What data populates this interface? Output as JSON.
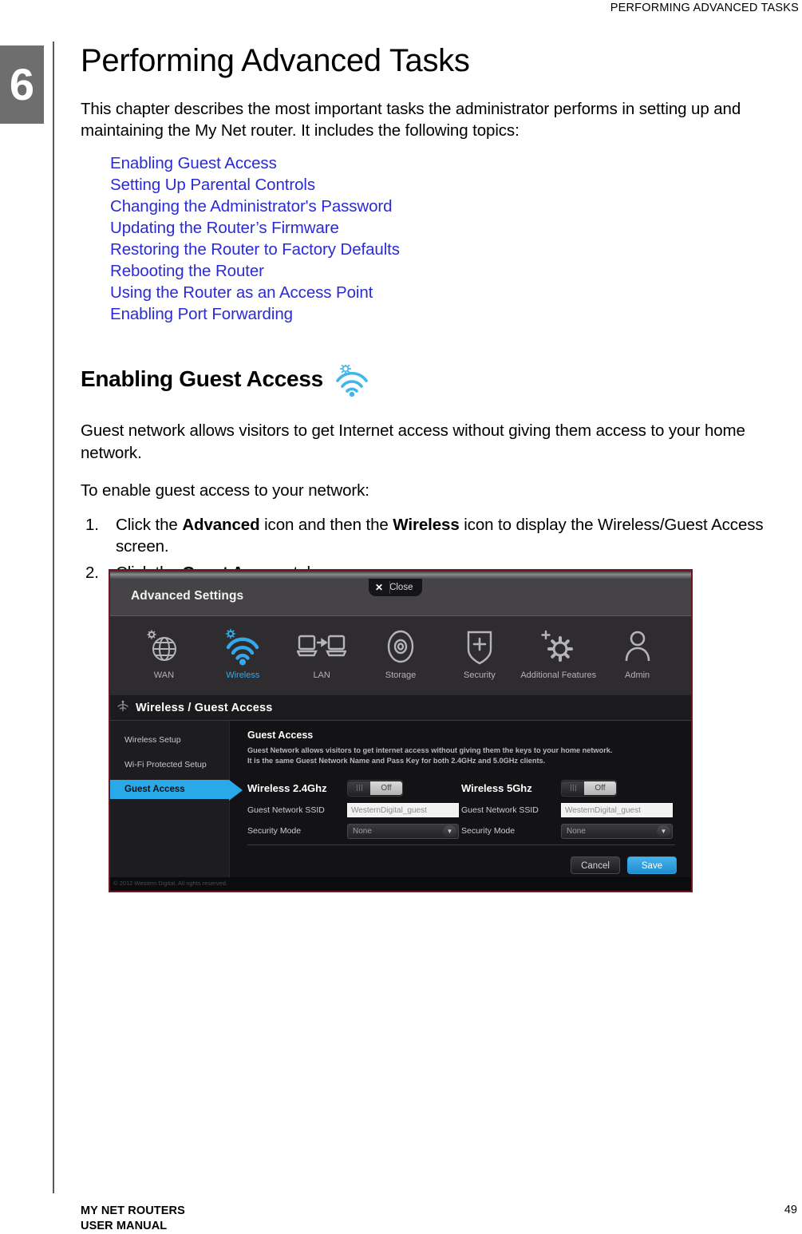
{
  "running_head": "PERFORMING ADVANCED TASKS",
  "chapter_number": "6",
  "page_title": "Performing Advanced Tasks",
  "intro": "This chapter describes the most important tasks the administrator performs in setting up and maintaining the My Net router. It includes the following topics:",
  "toc": [
    "Enabling Guest Access",
    "Setting Up Parental Controls",
    "Changing the Administrator's Password",
    "Updating the Router’s Firmware",
    "Restoring the Router to Factory Defaults",
    "Rebooting the Router",
    "Using the Router as an Access Point",
    "Enabling Port Forwarding"
  ],
  "section": {
    "heading": "Enabling Guest Access",
    "heading_icon": "wireless-gear-icon",
    "paragraph_1": "Guest network allows visitors to get Internet access without giving them access to your home network.",
    "paragraph_2": "To enable guest access to your network:",
    "steps": [
      {
        "num": "1.",
        "parts": [
          {
            "t": "Click the ",
            "b": false
          },
          {
            "t": "Advanced",
            "b": true
          },
          {
            "t": " icon and then the ",
            "b": false
          },
          {
            "t": "Wireless",
            "b": true
          },
          {
            "t": " icon to display the Wireless/Guest Access screen.",
            "b": false
          }
        ]
      },
      {
        "num": "2.",
        "parts": [
          {
            "t": "Click the ",
            "b": false
          },
          {
            "t": "Guest Access",
            "b": true
          },
          {
            "t": " tab.",
            "b": false
          }
        ]
      }
    ]
  },
  "screenshot": {
    "header_title": "Advanced Settings",
    "close_label": "Close",
    "close_x": "✕",
    "nav_icons": [
      {
        "label": "WAN",
        "icon": "globe-gear-icon",
        "active": false
      },
      {
        "label": "Wireless",
        "icon": "wifi-gear-icon",
        "active": true
      },
      {
        "label": "LAN",
        "icon": "computers-arrow-icon",
        "active": false
      },
      {
        "label": "Storage",
        "icon": "disk-icon",
        "active": false
      },
      {
        "label": "Security",
        "icon": "shield-plus-icon",
        "active": false
      },
      {
        "label": "Additional Features",
        "icon": "gear-plus-icon",
        "active": false
      },
      {
        "label": "Admin",
        "icon": "person-icon",
        "active": false
      }
    ],
    "breadcrumb": "Wireless / Guest Access",
    "breadcrumb_icon": "wifi-small-icon",
    "left_nav": [
      {
        "label": "Wireless Setup",
        "selected": false
      },
      {
        "label": "Wi-Fi Protected Setup",
        "selected": false
      },
      {
        "label": "Guest Access",
        "selected": true
      }
    ],
    "pane_title": "Guest Access",
    "pane_desc_line1": "Guest Network allows visitors to get internet access without giving them the keys to your home network.",
    "pane_desc_line2": "It is the same Guest Network Name and Pass Key for both 2.4GHz and 5.0GHz clients.",
    "bands": [
      {
        "title": "Wireless 2.4Ghz",
        "toggle_state": "Off",
        "ssid_label": "Guest Network SSID",
        "ssid_value": "WesternDigital_guest",
        "security_label": "Security Mode",
        "security_value": "None"
      },
      {
        "title": "Wireless 5Ghz",
        "toggle_state": "Off",
        "ssid_label": "Guest Network SSID",
        "ssid_value": "WesternDigital_guest",
        "security_label": "Security Mode",
        "security_value": "None"
      }
    ],
    "cancel_label": "Cancel",
    "save_label": "Save",
    "copyright": "© 2012 Western Digital. All rights reserved.",
    "accent_color": "#29a9e8",
    "border_color": "#6e1722"
  },
  "footer": {
    "line1": "MY NET ROUTERS",
    "line2": "USER MANUAL",
    "page_number": "49"
  }
}
